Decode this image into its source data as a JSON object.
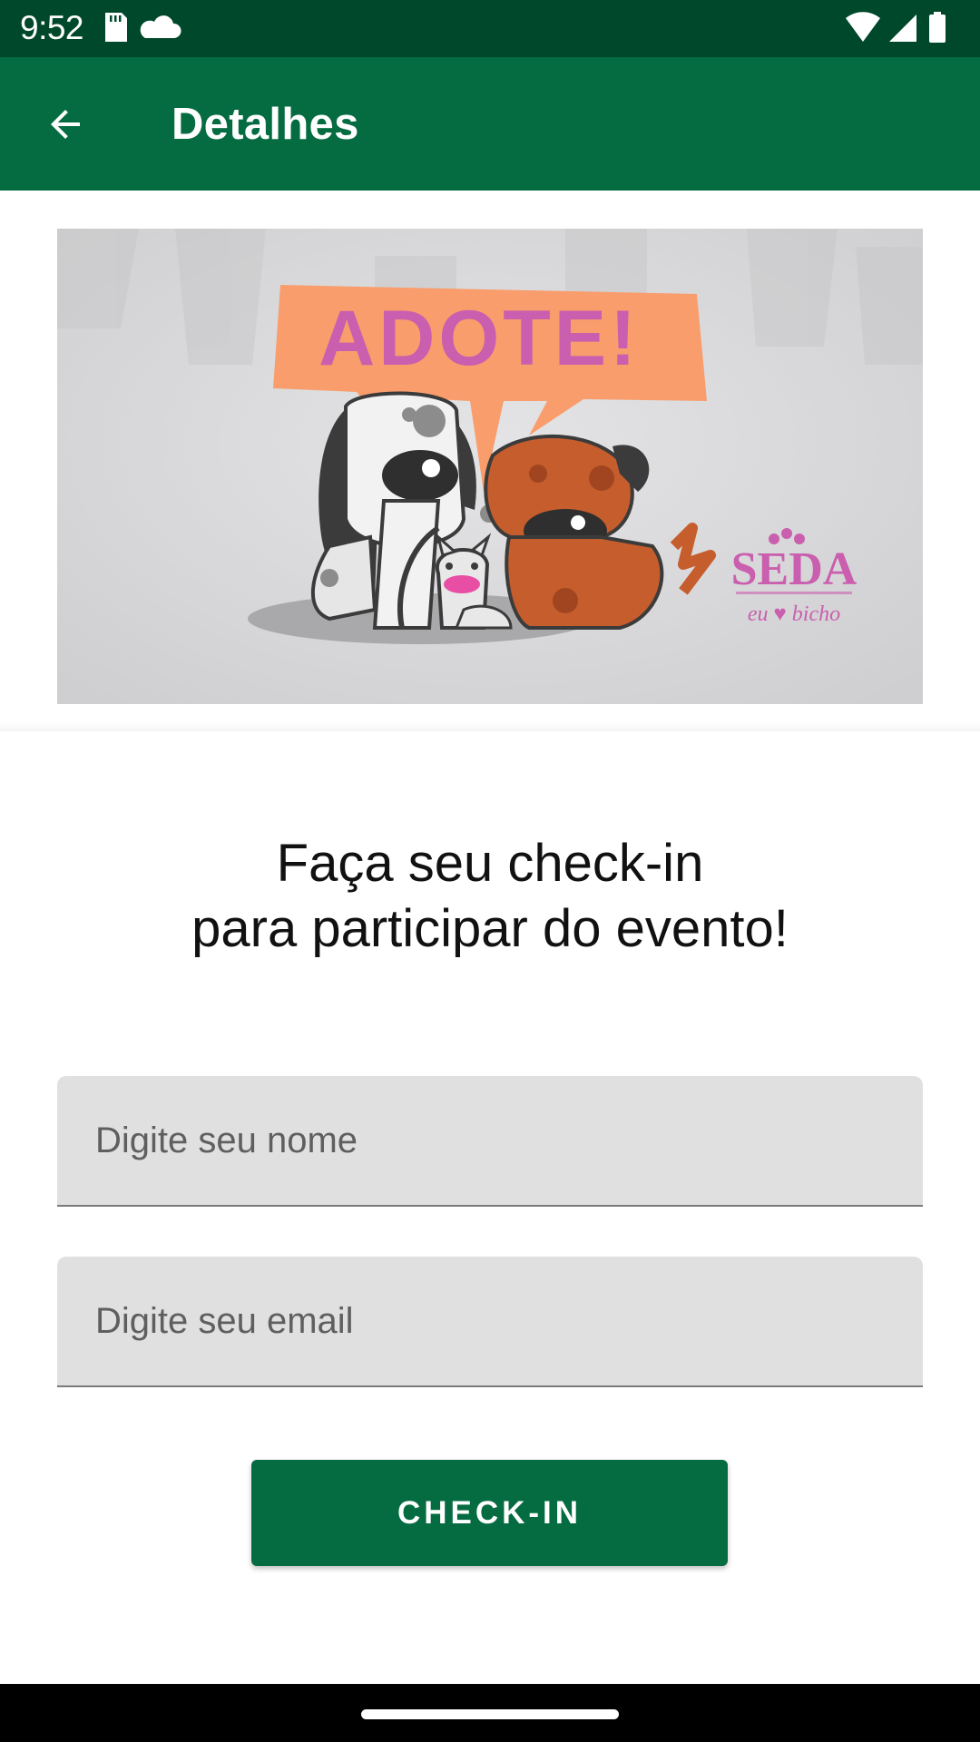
{
  "status_bar": {
    "time": "9:52",
    "left_icons": [
      "sd-card-icon",
      "cloud-icon"
    ],
    "right_icons": [
      "wifi-icon",
      "signal-icon",
      "battery-icon"
    ]
  },
  "app_bar": {
    "title": "Detalhes",
    "back_icon": "arrow-back-icon",
    "color": "#056c41"
  },
  "banner": {
    "bubble_text": "ADOTE!",
    "logo_text": "SEDA",
    "logo_tagline": "eu ♥ bicho",
    "bubble_color": "#f99d6c",
    "text_color": "#c95fae"
  },
  "checkin": {
    "headline_line1": "Faça seu check-in",
    "headline_line2": "para participar do evento!",
    "name_placeholder": "Digite seu nome",
    "email_placeholder": "Digite seu email",
    "button_label": "CHECK-IN",
    "button_color": "#056c41"
  }
}
